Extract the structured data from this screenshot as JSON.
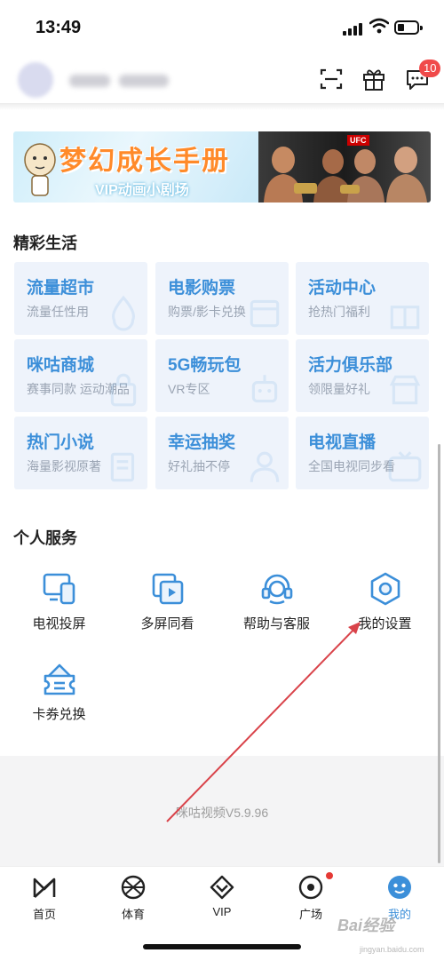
{
  "status_bar": {
    "time": "13:49"
  },
  "header": {
    "message_badge": "10"
  },
  "banner": {
    "title": "梦幻成长手册",
    "subtitle": "VIP动画小剧场",
    "right_tag": "UFC"
  },
  "life_section": {
    "title": "精彩生活",
    "items": [
      {
        "title": "流量超市",
        "subtitle": "流量任性用",
        "icon": "drop-icon"
      },
      {
        "title": "电影购票",
        "subtitle": "购票/影卡兑换",
        "icon": "film-icon"
      },
      {
        "title": "活动中心",
        "subtitle": "抢热门福利",
        "icon": "gift-icon"
      },
      {
        "title": "咪咕商城",
        "subtitle": "赛事同款 运动潮品",
        "icon": "bag-icon"
      },
      {
        "title": "5G畅玩包",
        "subtitle": "VR专区",
        "icon": "robot-icon"
      },
      {
        "title": "活力俱乐部",
        "subtitle": "领限量好礼",
        "icon": "shop-icon"
      },
      {
        "title": "热门小说",
        "subtitle": "海量影视原著",
        "icon": "book-icon"
      },
      {
        "title": "幸运抽奖",
        "subtitle": "好礼抽不停",
        "icon": "person-icon"
      },
      {
        "title": "电视直播",
        "subtitle": "全国电视同步看",
        "icon": "live-icon"
      }
    ]
  },
  "service_section": {
    "title": "个人服务",
    "items": [
      {
        "label": "电视投屏",
        "icon": "tv-cast-icon"
      },
      {
        "label": "多屏同看",
        "icon": "multi-screen-icon"
      },
      {
        "label": "帮助与客服",
        "icon": "headset-icon"
      },
      {
        "label": "我的设置",
        "icon": "settings-icon"
      },
      {
        "label": "卡券兑换",
        "icon": "coupon-icon"
      }
    ]
  },
  "footer": {
    "version": "咪咕视频V5.9.96"
  },
  "tabbar": {
    "tabs": [
      {
        "label": "首页",
        "icon": "home-icon"
      },
      {
        "label": "体育",
        "icon": "basketball-icon"
      },
      {
        "label": "VIP",
        "icon": "vip-icon"
      },
      {
        "label": "广场",
        "icon": "square-icon"
      },
      {
        "label": "我的",
        "icon": "me-icon"
      }
    ],
    "active_index": 4
  },
  "watermark": {
    "text": "Bai经验",
    "sub": "jingyan.baidu.com"
  },
  "colors": {
    "accent": "#3c8fd9",
    "badge": "#f04a4a",
    "annotation_arrow": "#d9434a"
  }
}
